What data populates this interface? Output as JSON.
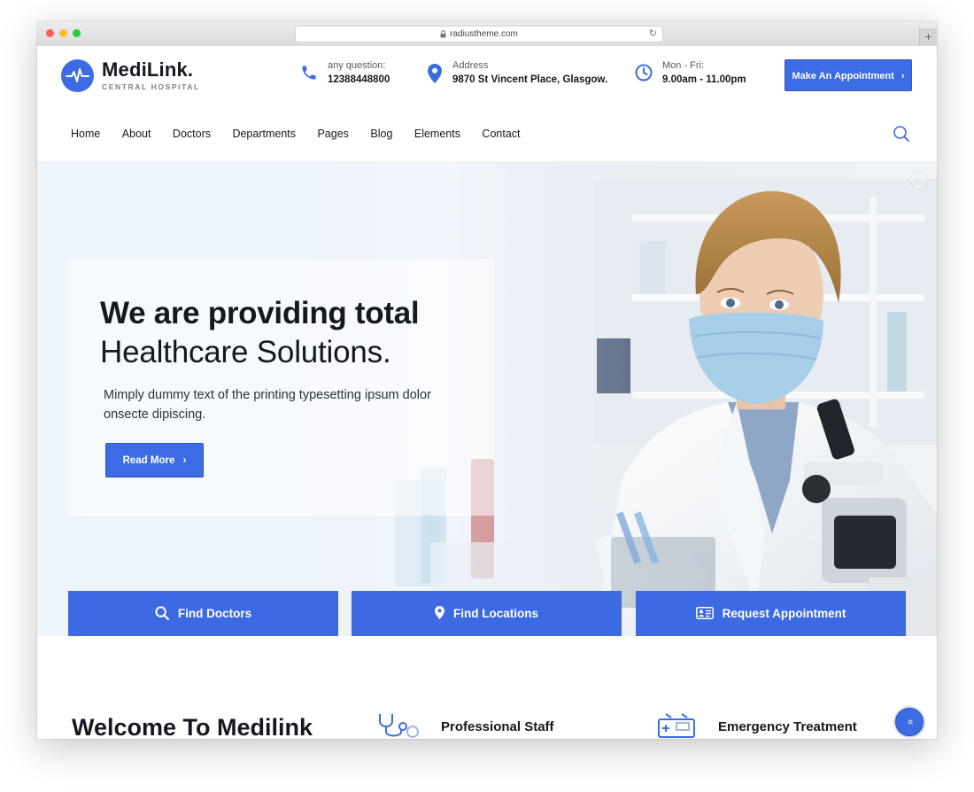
{
  "browser": {
    "url": "radiustheme.com"
  },
  "brand": {
    "name": "MediLink.",
    "subtitle": "CENTRAL HOSPITAL",
    "accent_color": "#3c6be3"
  },
  "header": {
    "contacts": [
      {
        "icon": "phone-icon",
        "label": "any question:",
        "value": "12388448800"
      },
      {
        "icon": "location-pin-icon",
        "label": "Address",
        "value": "9870 St Vincent Place, Glasgow."
      },
      {
        "icon": "clock-icon",
        "label": "Mon - Fri:",
        "value": "9.00am - 11.00pm"
      }
    ],
    "cta_label": "Make An Appointment",
    "cta_chevron": "›"
  },
  "nav": {
    "items": [
      "Home",
      "About",
      "Doctors",
      "Departments",
      "Pages",
      "Blog",
      "Elements",
      "Contact"
    ]
  },
  "hero": {
    "title_bold": "We are providing total",
    "title_light": "Healthcare Solutions.",
    "description": "Mimply dummy text of the printing typesetting ipsum dolor onsecte dipiscing.",
    "button_label": "Read More",
    "button_chevron": "›"
  },
  "features": [
    {
      "icon": "search-icon",
      "label": "Find Doctors"
    },
    {
      "icon": "location-pin-icon",
      "label": "Find Locations"
    },
    {
      "icon": "id-card-icon",
      "label": "Request Appointment"
    }
  ],
  "welcome": {
    "title": "Welcome To Medilink",
    "services": [
      {
        "icon": "stethoscope-icon",
        "label": "Professional Staff"
      },
      {
        "icon": "ambulance-icon",
        "label": "Emergency Treatment"
      }
    ]
  },
  "scroll_top_glyph": "»"
}
